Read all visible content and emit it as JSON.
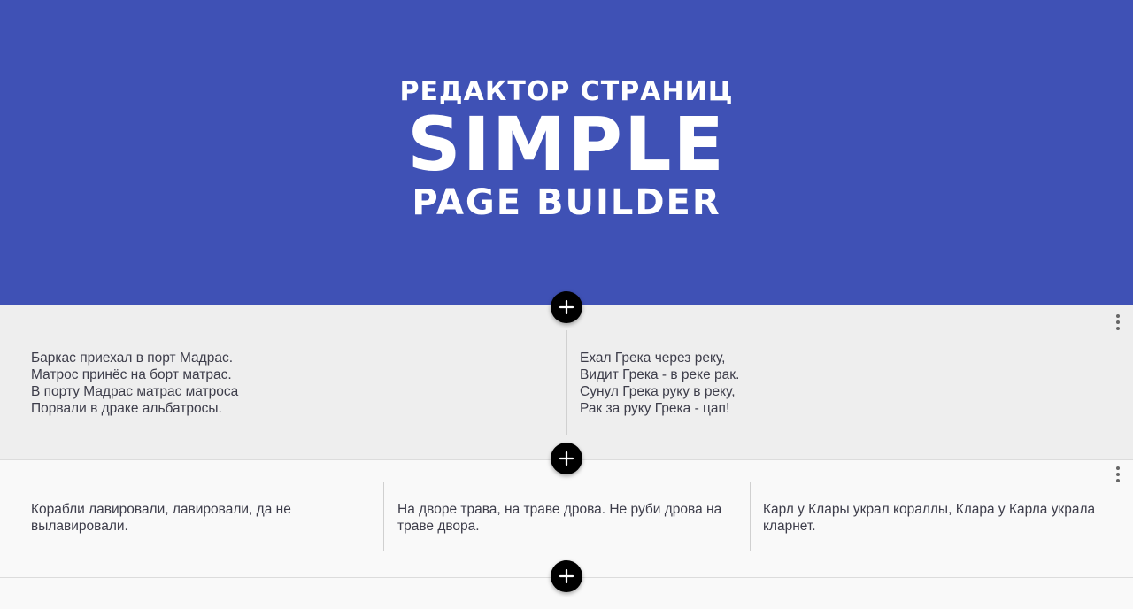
{
  "hero": {
    "line1": "РЕДАКТОР СТРАНИЦ",
    "line2": "SIMPLE",
    "line3": "PAGE BUILDER",
    "background": "#3f51b5"
  },
  "rows": [
    {
      "columns": [
        {
          "lines": [
            "Баркас приехал в порт Мадрас.",
            "Матрос принёс на борт матрас.",
            "В порту Мадрас матрас матроса",
            "Порвали в драке альбатросы."
          ]
        },
        {
          "lines": [
            "Ехал Грека через реку,",
            "Видит Грека - в реке рак.",
            "Сунул Грека руку в реку,",
            "Рак за руку Грека - цап!"
          ]
        }
      ]
    },
    {
      "columns": [
        {
          "text": "Корабли лавировали, лавировали, да не вылавировали."
        },
        {
          "text": "На дворе трава, на траве дрова. Не руби дрова на траве двора."
        },
        {
          "text": "Карл у Клары украл кораллы, Клара у Карла украла кларнет."
        }
      ]
    }
  ],
  "icons": {
    "add": "plus-icon",
    "row_menu": "more-vert-icon"
  }
}
